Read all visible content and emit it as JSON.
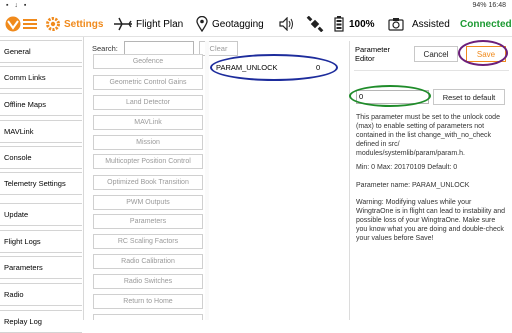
{
  "status_bar": {
    "left_icons": "▪ ↓ ▪",
    "right": "94% 16:48"
  },
  "toolbar": {
    "settings": "Settings",
    "flight_plan": "Flight Plan",
    "geotagging": "Geotagging",
    "battery": "100%",
    "assisted": "Assisted",
    "connected": "Connected",
    "connected_color": "#1c9a32",
    "accent_color": "#f08a1c"
  },
  "nav": {
    "items": [
      "General",
      "Comm Links",
      "Offline Maps",
      "MAVLink",
      "Console",
      "Telemetry Settings",
      "Update",
      "Flight Logs",
      "Parameters",
      "Radio",
      "Replay Log"
    ]
  },
  "search": {
    "label": "Search:",
    "value": "",
    "clear": "Clear"
  },
  "groups": [
    "Geofence",
    "Geometric Control Gains",
    "Land Detector",
    "MAVLink",
    "Mission",
    "Multicopter Position Control",
    "Optimized Book Transition",
    "PWM Outputs",
    "Parameters",
    "RC Scaling Factors",
    "Radio Calibration",
    "Radio Switches",
    "Return to Home"
  ],
  "param_row": {
    "name": "PARAM_UNLOCK",
    "value": "0"
  },
  "editor": {
    "title": "Parameter Editor",
    "cancel": "Cancel",
    "save": "Save",
    "value": "0",
    "reset": "Reset to default",
    "description": "This parameter must be set to the unlock code (max) to enable setting of parameters not contained in the list change_with_no_check defined in src/ modules/systemlib/param/param.h.",
    "range": "Min: 0  Max: 20170109  Default: 0",
    "param_name": "Parameter name: PARAM_UNLOCK",
    "warning": "Warning: Modifying values while your WingtraOne is in flight can lead to instability and possible loss of your WingtraOne. Make sure you know what you are doing and double-check your values before Save!"
  },
  "annotation_colors": {
    "blue": "#1d2c9c",
    "green": "#1f8c2a",
    "purple": "#6b1f7a"
  }
}
